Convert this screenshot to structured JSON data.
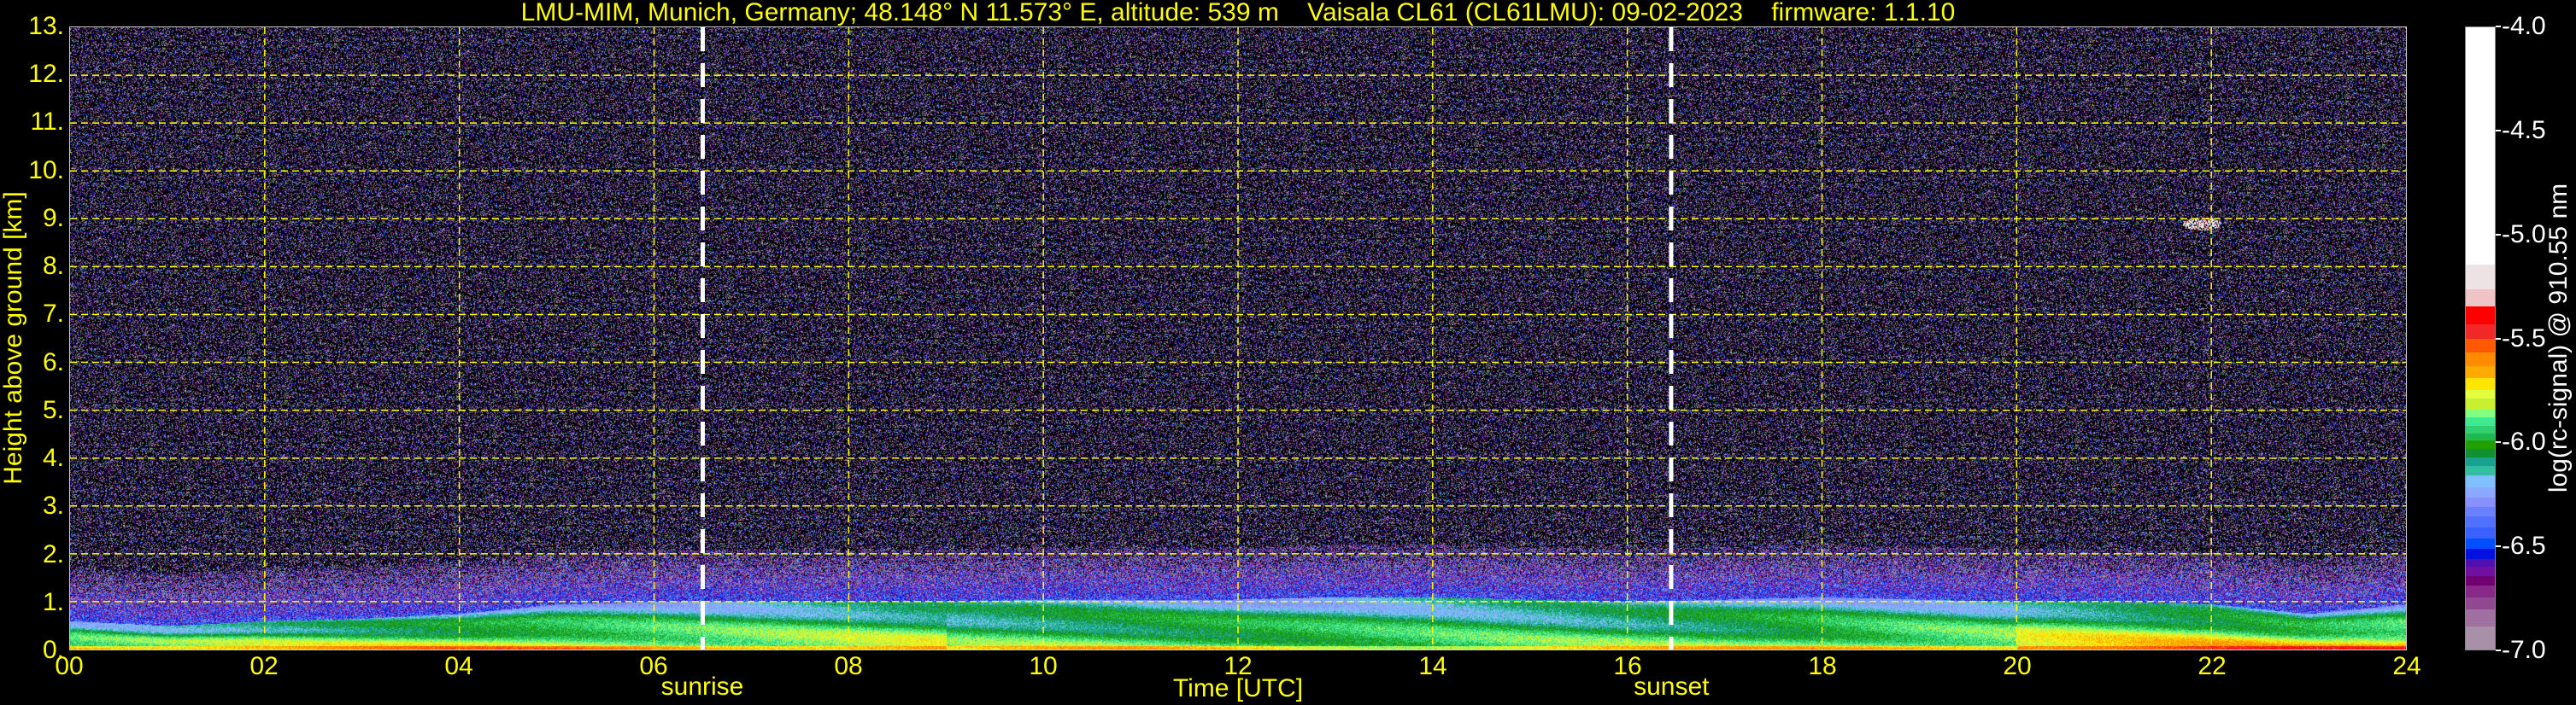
{
  "title": "LMU-MIM, Munich, Germany; 48.148° N 11.573° E, altitude: 539 m    Vaisala CL61 (CL61LMU): 09-02-2023    firmware: 1.1.10",
  "chart_data": {
    "type": "heatmap",
    "title": "LMU-MIM, Munich, Germany; 48.148° N 11.573° E, altitude: 539 m    Vaisala CL61 (CL61LMU): 09-02-2023    firmware: 1.1.10",
    "xlabel": "Time [UTC]",
    "ylabel": "Height above ground [km]",
    "xlim": [
      0,
      24
    ],
    "ylim": [
      0,
      13
    ],
    "x_ticks": [
      "00",
      "02",
      "04",
      "06",
      "08",
      "10",
      "12",
      "14",
      "16",
      "18",
      "20",
      "22",
      "24"
    ],
    "y_ticks": [
      "0.",
      "1.",
      "2.",
      "3.",
      "4.",
      "5.",
      "6.",
      "7.",
      "8.",
      "9.",
      "10.",
      "11.",
      "12.",
      "13."
    ],
    "grid": true,
    "annotations": [
      {
        "label": "sunrise",
        "time": 6.5
      },
      {
        "label": "sunset",
        "time": 16.45
      }
    ],
    "aerosol_layer_top_km": {
      "time": [
        0,
        1,
        2,
        3,
        4,
        5,
        6,
        7,
        8,
        9,
        10,
        11,
        12,
        13,
        14,
        15,
        16,
        17,
        18,
        19,
        20,
        21,
        22,
        23,
        24
      ],
      "height": [
        0.6,
        0.5,
        0.6,
        0.65,
        0.75,
        0.95,
        1.0,
        1.0,
        1.0,
        1.0,
        1.05,
        1.05,
        1.05,
        1.1,
        1.1,
        1.05,
        1.0,
        1.05,
        1.1,
        1.05,
        1.0,
        1.0,
        0.95,
        0.75,
        0.95
      ]
    },
    "cloud_feature": {
      "time": 21.9,
      "height_km": 8.9
    },
    "colorbar": {
      "label": "log(rc-signal) @ 910.55 nm",
      "range": [
        -7.0,
        -4.0
      ],
      "ticks": [
        "-4.0",
        "-4.5",
        "-5.0",
        "-5.5",
        "-6.0",
        "-6.5",
        "-7.0"
      ],
      "segments": [
        {
          "from": -7.0,
          "to": -6.885,
          "color": "#a890a8"
        },
        {
          "from": -6.885,
          "to": -6.805,
          "color": "#a070a0"
        },
        {
          "from": -6.805,
          "to": -6.745,
          "color": "#904890"
        },
        {
          "from": -6.745,
          "to": -6.69,
          "color": "#882888"
        },
        {
          "from": -6.69,
          "to": -6.645,
          "color": "#700070"
        },
        {
          "from": -6.645,
          "to": -6.6,
          "color": "#7010a0"
        },
        {
          "from": -6.6,
          "to": -6.56,
          "color": "#5010b0"
        },
        {
          "from": -6.56,
          "to": -6.512,
          "color": "#0010e0"
        },
        {
          "from": -6.512,
          "to": -6.462,
          "color": "#0050ff"
        },
        {
          "from": -6.462,
          "to": -6.41,
          "color": "#3a60ff"
        },
        {
          "from": -6.41,
          "to": -6.355,
          "color": "#5070ff"
        },
        {
          "from": -6.355,
          "to": -6.31,
          "color": "#6a80ff"
        },
        {
          "from": -6.31,
          "to": -6.265,
          "color": "#8890ff"
        },
        {
          "from": -6.265,
          "to": -6.215,
          "color": "#8aa8ff"
        },
        {
          "from": -6.215,
          "to": -6.16,
          "color": "#80c0ff"
        },
        {
          "from": -6.16,
          "to": -6.115,
          "color": "#30c0a0"
        },
        {
          "from": -6.115,
          "to": -6.072,
          "color": "#18a090"
        },
        {
          "from": -6.072,
          "to": -6.03,
          "color": "#109030"
        },
        {
          "from": -6.03,
          "to": -5.99,
          "color": "#20a000"
        },
        {
          "from": -5.99,
          "to": -5.957,
          "color": "#20b850"
        },
        {
          "from": -5.957,
          "to": -5.92,
          "color": "#30d070"
        },
        {
          "from": -5.92,
          "to": -5.88,
          "color": "#40e890"
        },
        {
          "from": -5.88,
          "to": -5.84,
          "color": "#80ff80"
        },
        {
          "from": -5.84,
          "to": -5.79,
          "color": "#c8f030"
        },
        {
          "from": -5.79,
          "to": -5.747,
          "color": "#e0ff40"
        },
        {
          "from": -5.747,
          "to": -5.69,
          "color": "#ffe600"
        },
        {
          "from": -5.69,
          "to": -5.63,
          "color": "#ffaa00"
        },
        {
          "from": -5.63,
          "to": -5.565,
          "color": "#ff8c00"
        },
        {
          "from": -5.565,
          "to": -5.5,
          "color": "#ff5a00"
        },
        {
          "from": -5.5,
          "to": -5.43,
          "color": "#f02828"
        },
        {
          "from": -5.43,
          "to": -5.345,
          "color": "#ff0000"
        },
        {
          "from": -5.345,
          "to": -5.26,
          "color": "#f0c4c6"
        },
        {
          "from": -5.26,
          "to": -5.14,
          "color": "#ede3e5"
        },
        {
          "from": -5.14,
          "to": -4.0,
          "color": "#ffffff"
        }
      ]
    }
  },
  "colors": {
    "axis_text": "#ffff00",
    "grid": "#ffff00",
    "background": "#000000",
    "sun_lines": "#ffffff"
  }
}
